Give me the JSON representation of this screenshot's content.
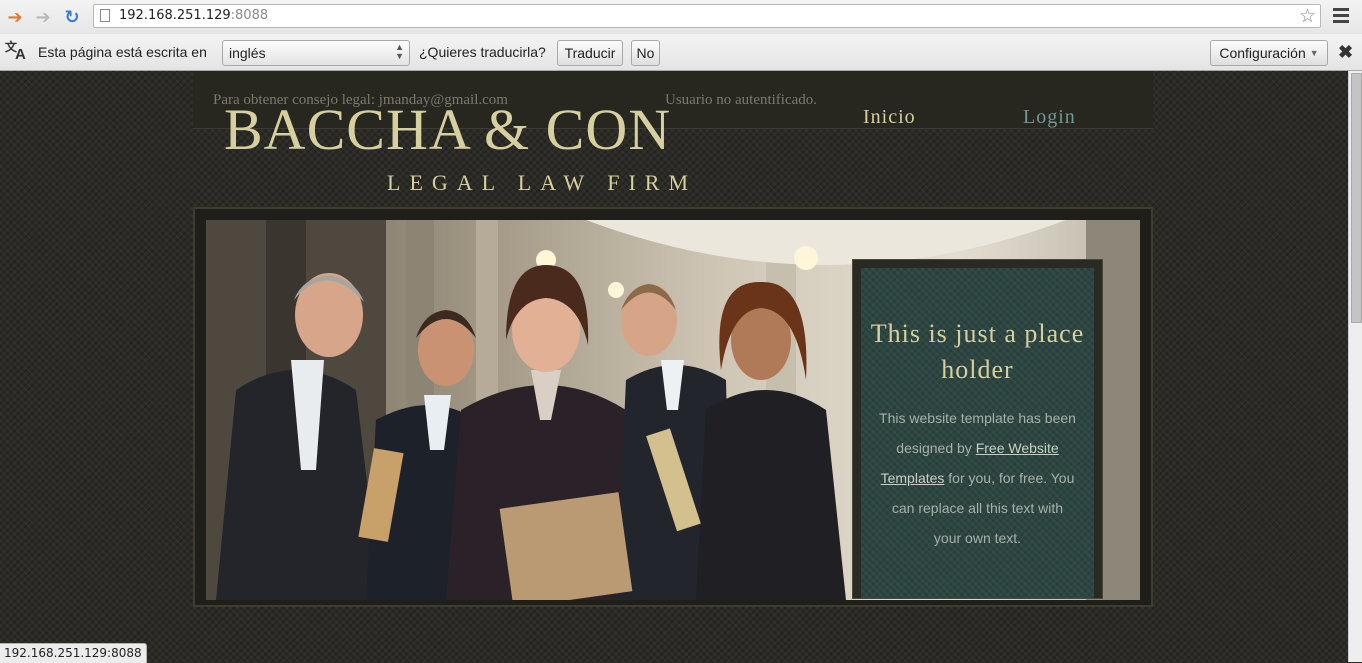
{
  "browser": {
    "url_host": "192.168.251.129",
    "url_port": ":8088",
    "status_url": "192.168.251.129:8088"
  },
  "translate_bar": {
    "prompt": "Esta página está escrita en",
    "language": "inglés",
    "question": "¿Quieres traducirla?",
    "translate_label": "Traducir",
    "no_label": "No",
    "settings_label": "Configuración"
  },
  "site": {
    "contact": "Para obtener consejo legal: jmanday@gmail.com",
    "auth_status": "Usuario no autentificado.",
    "logo_title": "BACCHA & CON",
    "logo_subtitle": "LEGAL LAW FIRM",
    "nav": {
      "home": "Inicio",
      "login": "Login"
    },
    "callout": {
      "title": "This is just a place holder",
      "text_before": "This website template has been designed by ",
      "link_text": "Free Website Templates",
      "text_after": " for you, for free. You can replace all this text with your own text."
    }
  },
  "colors": {
    "accent_gold": "#d6cfa0",
    "login_teal": "#6f9c96",
    "callout_bg": "#2c4541"
  }
}
